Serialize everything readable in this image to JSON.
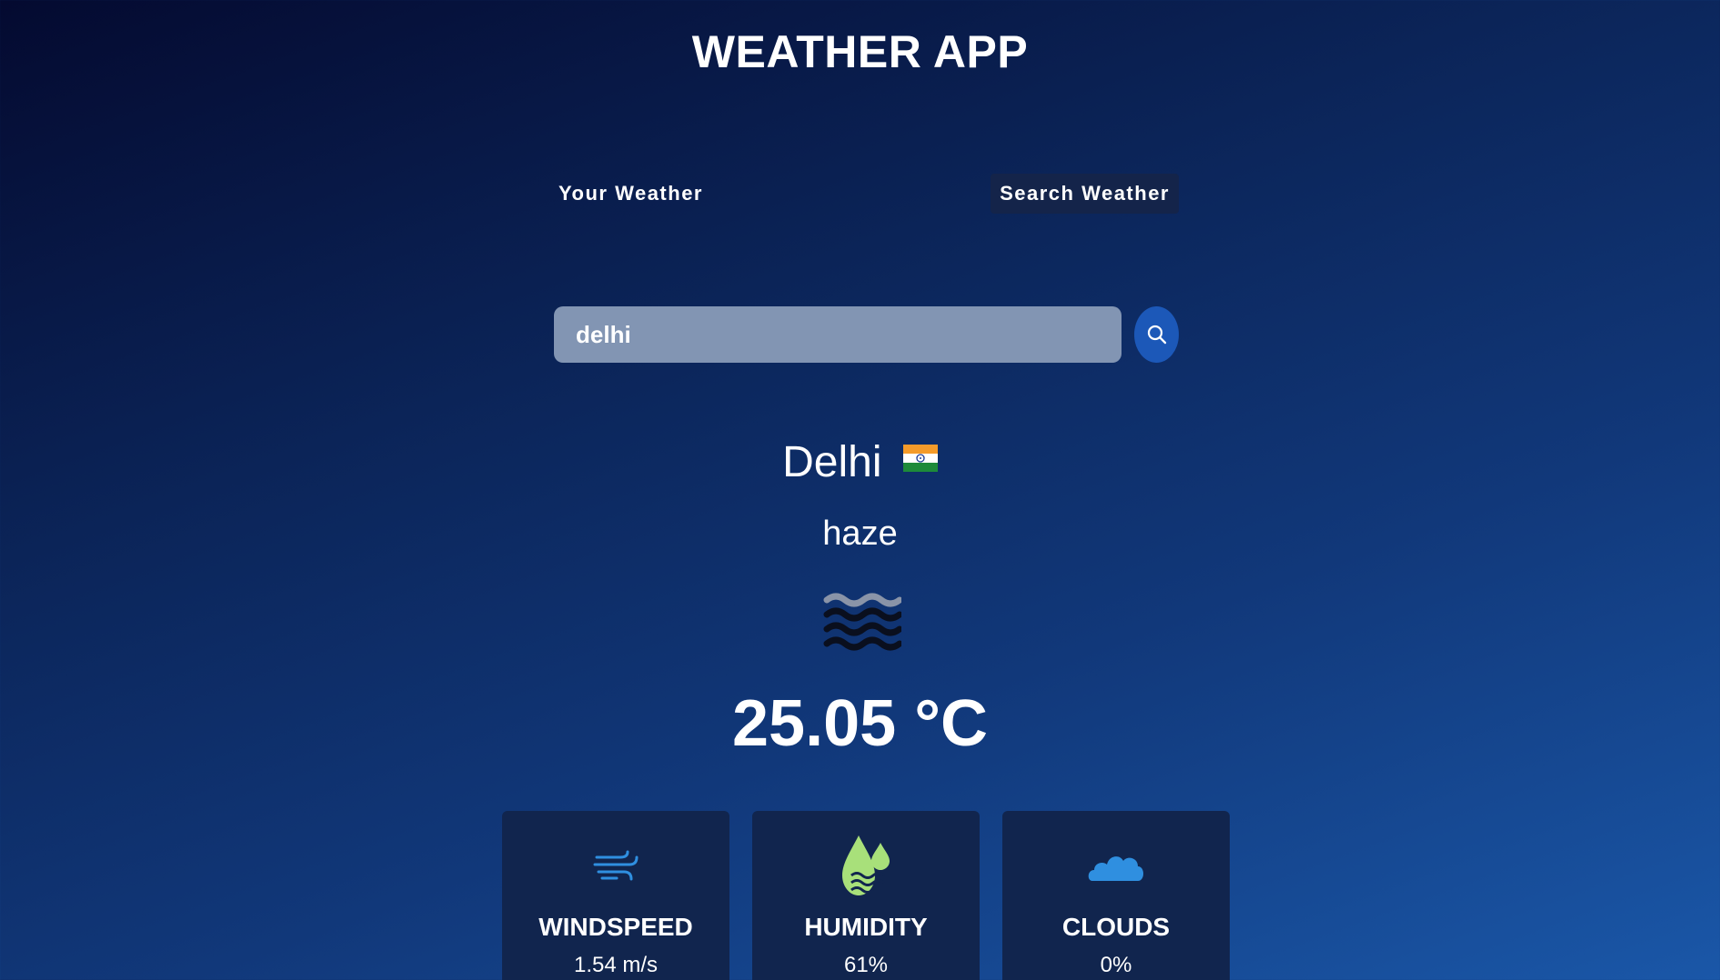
{
  "app": {
    "title": "WEATHER APP"
  },
  "tabs": {
    "your_weather": "Your Weather",
    "search_weather": "Search Weather",
    "active": "search_weather"
  },
  "search": {
    "value": "delhi",
    "button_icon": "search-icon"
  },
  "weather": {
    "city": "Delhi",
    "country_flag": "india-flag-icon",
    "description": "haze",
    "condition_icon": "haze-icon",
    "temperature": "25.05 °C"
  },
  "cards": {
    "windspeed": {
      "label": "WINDSPEED",
      "value": "1.54 m/s",
      "icon": "wind-icon"
    },
    "humidity": {
      "label": "HUMIDITY",
      "value": "61%",
      "icon": "humidity-icon"
    },
    "clouds": {
      "label": "CLOUDS",
      "value": "0%",
      "icon": "cloud-icon"
    }
  },
  "colors": {
    "background_top": "#040a30",
    "background_bottom": "#1a57a8",
    "card_background": "#11254e",
    "search_button": "#1c58b8",
    "search_input": "#8295b3"
  }
}
